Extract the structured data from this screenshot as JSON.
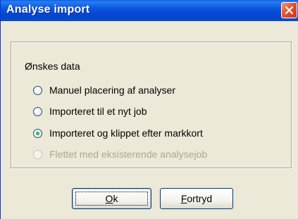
{
  "window": {
    "title": "Analyse import"
  },
  "group": {
    "caption": "Ønskes data",
    "options": [
      {
        "label": "Manuel placering af analyser",
        "checked": false,
        "disabled": false
      },
      {
        "label": "Importeret til et nyt job",
        "checked": false,
        "disabled": false
      },
      {
        "label": "Importeret og klippet efter markkort",
        "checked": true,
        "disabled": false
      },
      {
        "label": "Flettet med eksisterende analysejob",
        "checked": false,
        "disabled": true
      }
    ]
  },
  "buttons": {
    "ok": {
      "mnemonic": "O",
      "rest": "k"
    },
    "cancel": {
      "mnemonic": "F",
      "rest": "ortryd"
    }
  },
  "icons": {
    "close": "close-icon"
  },
  "colors": {
    "titlebar": "#0a57e0",
    "close_button": "#e3532e",
    "dialog_bg": "#ece9d8",
    "radio_dot": "#21a121",
    "disabled_text": "#aca899"
  }
}
